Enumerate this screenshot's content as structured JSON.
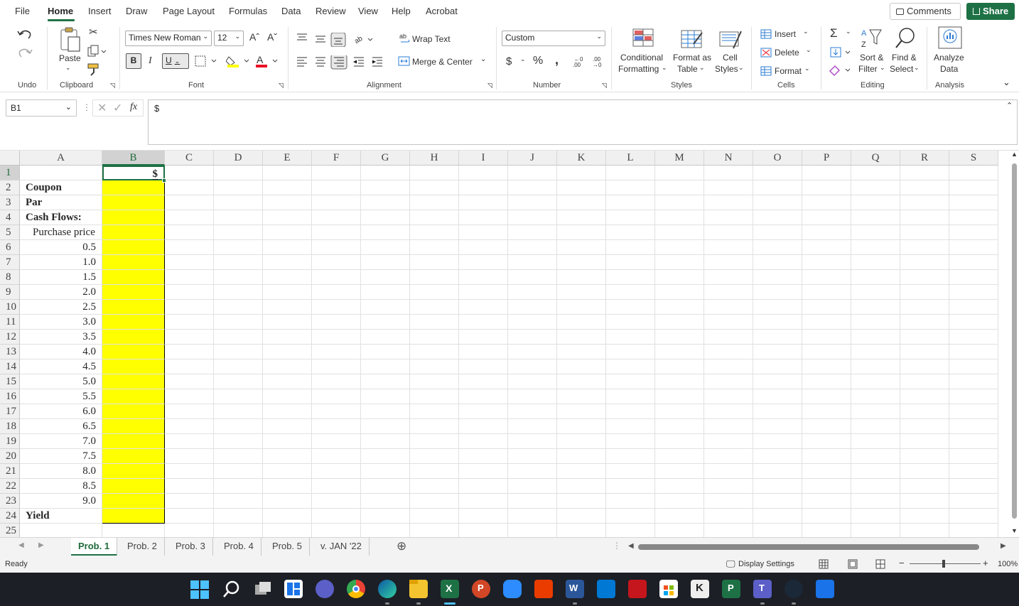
{
  "menu": {
    "items": [
      "File",
      "Home",
      "Insert",
      "Draw",
      "Page Layout",
      "Formulas",
      "Data",
      "Review",
      "View",
      "Help",
      "Acrobat"
    ],
    "active": "Home",
    "comments": "Comments",
    "share": "Share"
  },
  "ribbon": {
    "groups": {
      "undo": "Undo",
      "clipboard": "Clipboard",
      "font": "Font",
      "alignment": "Alignment",
      "number": "Number",
      "styles": "Styles",
      "cells": "Cells",
      "editing": "Editing",
      "analysis": "Analysis"
    },
    "paste": "Paste",
    "font_name": "Times New Roman",
    "font_size": "12",
    "bold": "B",
    "italic": "I",
    "underline": "U",
    "wrap_text": "Wrap Text",
    "merge_center": "Merge & Center",
    "number_format": "Custom",
    "currency": "$",
    "percent": "%",
    "comma": ",",
    "cond_formatting": [
      "Conditional",
      "Formatting"
    ],
    "format_as_table": [
      "Format as",
      "Table"
    ],
    "cell_styles": [
      "Cell",
      "Styles"
    ],
    "insert": "Insert",
    "delete": "Delete",
    "format": "Format",
    "sort_filter": [
      "Sort &",
      "Filter"
    ],
    "find_select": [
      "Find &",
      "Select"
    ],
    "analyze_data": [
      "Analyze",
      "Data"
    ]
  },
  "formula_bar": {
    "name_box": "B1",
    "fx": "fx",
    "value": "$"
  },
  "sheet": {
    "columns": [
      "A",
      "B",
      "C",
      "D",
      "E",
      "F",
      "G",
      "H",
      "I",
      "J",
      "K",
      "L",
      "M",
      "N",
      "O",
      "P",
      "Q",
      "R",
      "S"
    ],
    "selected_col": "B",
    "selected_row": "1",
    "rows": [
      {
        "n": "1",
        "a": "",
        "b": "$"
      },
      {
        "n": "2",
        "a": "Coupon",
        "b": ""
      },
      {
        "n": "3",
        "a": "Par",
        "b": ""
      },
      {
        "n": "4",
        "a": "Cash Flows:",
        "b": ""
      },
      {
        "n": "5",
        "a": "Purchase price",
        "b": ""
      },
      {
        "n": "6",
        "a": "0.5",
        "b": ""
      },
      {
        "n": "7",
        "a": "1.0",
        "b": ""
      },
      {
        "n": "8",
        "a": "1.5",
        "b": ""
      },
      {
        "n": "9",
        "a": "2.0",
        "b": ""
      },
      {
        "n": "10",
        "a": "2.5",
        "b": ""
      },
      {
        "n": "11",
        "a": "3.0",
        "b": ""
      },
      {
        "n": "12",
        "a": "3.5",
        "b": ""
      },
      {
        "n": "13",
        "a": "4.0",
        "b": ""
      },
      {
        "n": "14",
        "a": "4.5",
        "b": ""
      },
      {
        "n": "15",
        "a": "5.0",
        "b": ""
      },
      {
        "n": "16",
        "a": "5.5",
        "b": ""
      },
      {
        "n": "17",
        "a": "6.0",
        "b": ""
      },
      {
        "n": "18",
        "a": "6.5",
        "b": ""
      },
      {
        "n": "19",
        "a": "7.0",
        "b": ""
      },
      {
        "n": "20",
        "a": "7.5",
        "b": ""
      },
      {
        "n": "21",
        "a": "8.0",
        "b": ""
      },
      {
        "n": "22",
        "a": "8.5",
        "b": ""
      },
      {
        "n": "23",
        "a": "9.0",
        "b": ""
      },
      {
        "n": "24",
        "a": "Yield",
        "b": ""
      },
      {
        "n": "25",
        "a": "",
        "b": ""
      }
    ],
    "highlight_color": "#ffff00"
  },
  "tabs": [
    "Prob. 1",
    "Prob. 2",
    "Prob. 3",
    "Prob. 4",
    "Prob. 5",
    "v. JAN '22"
  ],
  "active_tab": "Prob. 1",
  "status": {
    "ready": "Ready",
    "display_settings": "Display Settings",
    "zoom": "100%"
  },
  "colors": {
    "accent": "#217346",
    "share_bg": "#1e7145",
    "taskbar": "#1c1f26"
  }
}
